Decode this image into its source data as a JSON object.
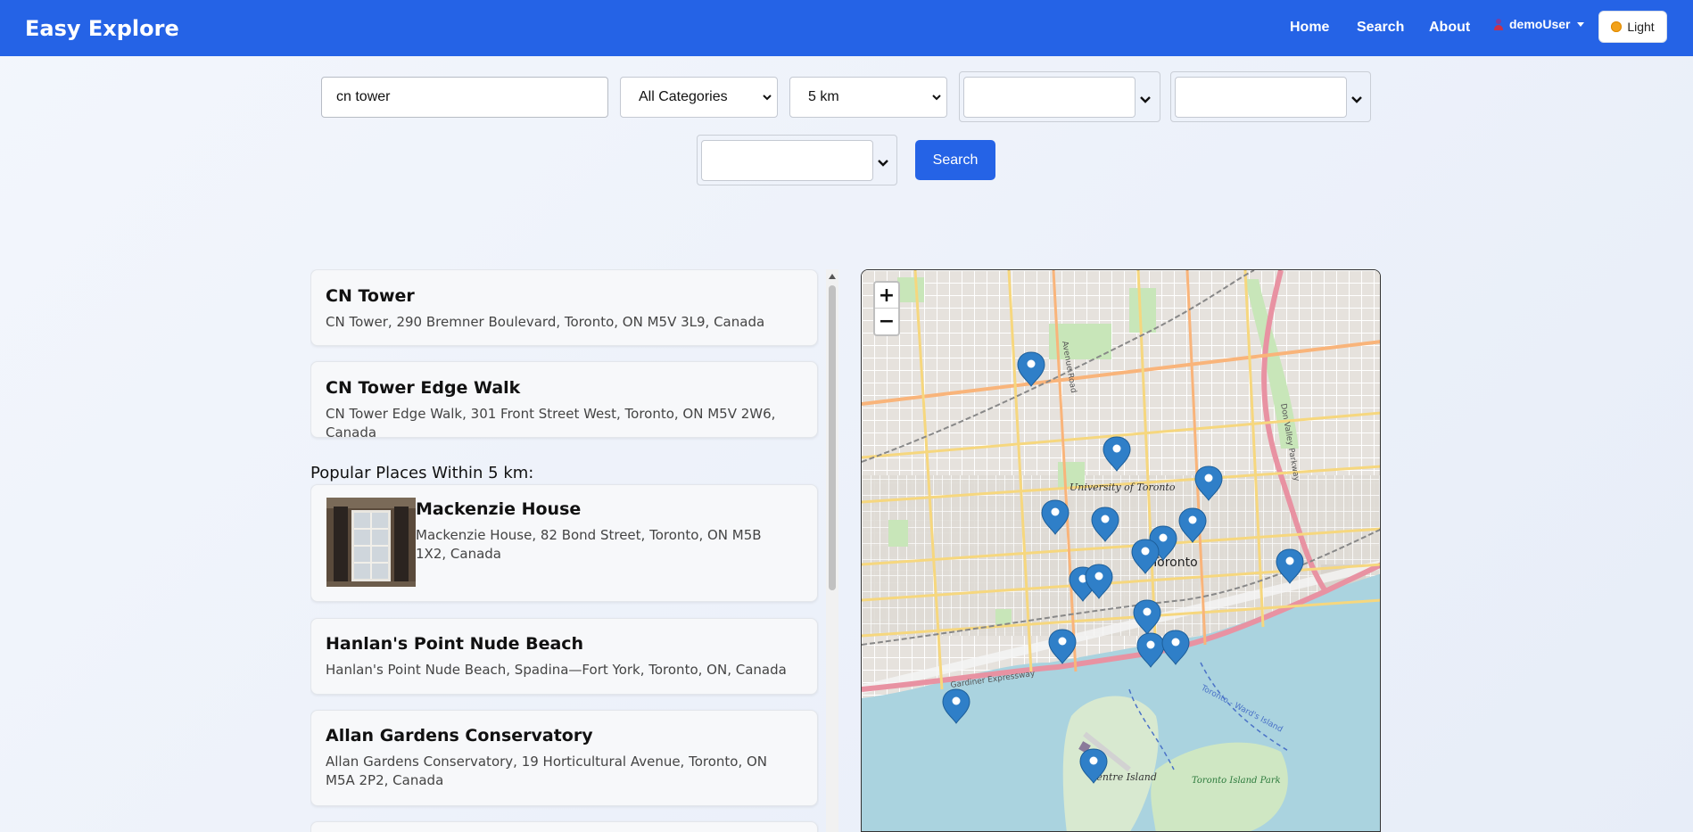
{
  "app": {
    "brand": "Easy Explore"
  },
  "nav": {
    "home": "Home",
    "search": "Search",
    "about": "About",
    "user": "demoUser",
    "theme": "Light"
  },
  "search": {
    "query": "cn tower",
    "category": "All Categories",
    "radius": "5 km",
    "button": "Search"
  },
  "results": [
    {
      "title": "CN Tower",
      "address": "CN Tower, 290 Bremner Boulevard, Toronto, ON M5V 3L9, Canada"
    },
    {
      "title": "CN Tower Edge Walk",
      "address": "CN Tower Edge Walk, 301 Front Street West, Toronto, ON M5V 2W6, Canada"
    }
  ],
  "popular": {
    "heading": "Popular Places Within 5 km:",
    "items": [
      {
        "title": "Mackenzie House",
        "address": "Mackenzie House, 82 Bond Street, Toronto, ON M5B 1X2, Canada"
      },
      {
        "title": "Hanlan's Point Nude Beach",
        "address": "Hanlan's Point Nude Beach, Spadina—Fort York, Toronto, ON, Canada"
      },
      {
        "title": "Allan Gardens Conservatory",
        "address": "Allan Gardens Conservatory, 19 Horticultural Avenue, Toronto, ON M5A 2P2, Canada"
      }
    ]
  },
  "map": {
    "zoom_in": "+",
    "zoom_out": "−",
    "labels": {
      "university": "University of Toronto",
      "toronto": "Toronto",
      "centre_island": "Centre Island",
      "island_park": "Toronto Island Park",
      "gardiner": "Gardiner Expressway",
      "ferry": "Toronto - Ward's Island",
      "avenue_road": "Avenue Road",
      "dvp": "Don Valley Parkway"
    },
    "marker_count": 17
  },
  "colors": {
    "primary": "#2563e6",
    "marker": "#2f7fc8"
  }
}
